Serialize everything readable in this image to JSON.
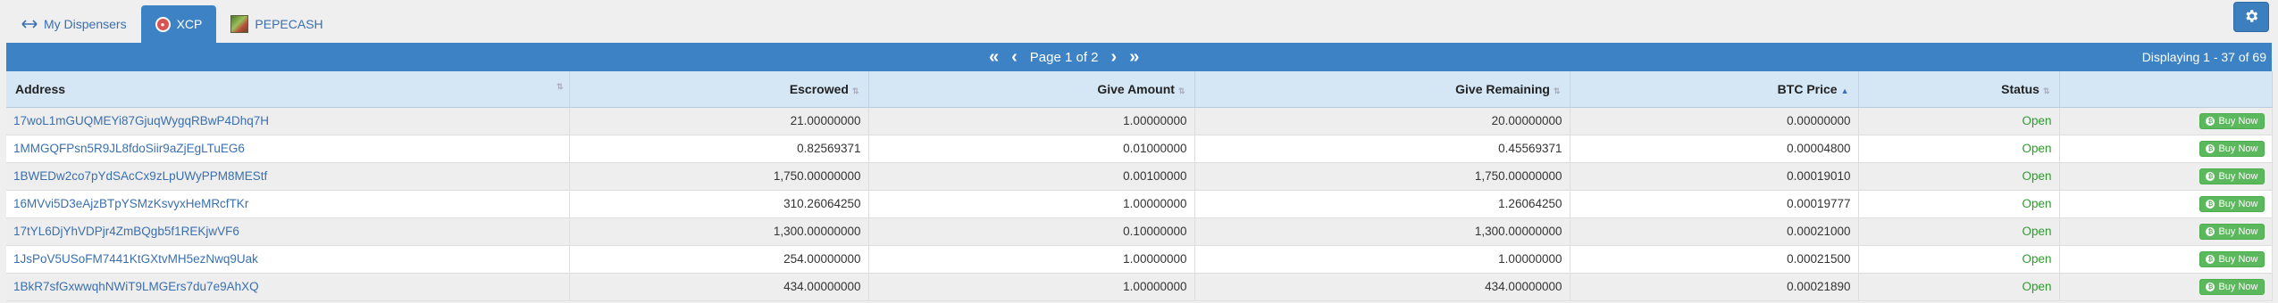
{
  "tabs": [
    {
      "label": "My Dispensers",
      "icon": "double-arrow-icon"
    },
    {
      "label": "XCP",
      "icon": "xcp-logo-icon",
      "active": true
    },
    {
      "label": "PEPECASH",
      "icon": "pepecash-logo-icon"
    }
  ],
  "settings": {
    "icon": "gear-icon"
  },
  "pager": {
    "page_text": "Page 1 of 2",
    "displaying": "Displaying 1 - 37 of 69"
  },
  "columns": [
    "Address",
    "Escrowed",
    "Give Amount",
    "Give Remaining",
    "BTC Price",
    "Status",
    ""
  ],
  "rows": [
    {
      "address": "17woL1mGUQMEYi87GjuqWygqRBwP4Dhq7H",
      "escrowed": "21.00000000",
      "give_amount": "1.00000000",
      "give_remaining": "20.00000000",
      "btc_price": "0.00000000",
      "status": "Open",
      "action": "Buy Now"
    },
    {
      "address": "1MMGQFPsn5R9JL8fdoSiir9aZjEgLTuEG6",
      "escrowed": "0.82569371",
      "give_amount": "0.01000000",
      "give_remaining": "0.45569371",
      "btc_price": "0.00004800",
      "status": "Open",
      "action": "Buy Now"
    },
    {
      "address": "1BWEDw2co7pYdSAcCx9zLpUWyPPM8MEStf",
      "escrowed": "1,750.00000000",
      "give_amount": "0.00100000",
      "give_remaining": "1,750.00000000",
      "btc_price": "0.00019010",
      "status": "Open",
      "action": "Buy Now"
    },
    {
      "address": "16MVvi5D3eAjzBTpYSMzKsvyxHeMRcfTKr",
      "escrowed": "310.26064250",
      "give_amount": "1.00000000",
      "give_remaining": "1.26064250",
      "btc_price": "0.00019777",
      "status": "Open",
      "action": "Buy Now"
    },
    {
      "address": "17tYL6DjYhVDPjr4ZmBQgb5f1REKjwVF6",
      "escrowed": "1,300.00000000",
      "give_amount": "0.10000000",
      "give_remaining": "1,300.00000000",
      "btc_price": "0.00021000",
      "status": "Open",
      "action": "Buy Now"
    },
    {
      "address": "1JsPoV5USoFM7441KtGXtvMH5ezNwq9Uak",
      "escrowed": "254.00000000",
      "give_amount": "1.00000000",
      "give_remaining": "1.00000000",
      "btc_price": "0.00021500",
      "status": "Open",
      "action": "Buy Now"
    },
    {
      "address": "1BkR7sfGxwwqhNWiT9LMGErs7du7e9AhXQ",
      "escrowed": "434.00000000",
      "give_amount": "1.00000000",
      "give_remaining": "434.00000000",
      "btc_price": "0.00021890",
      "status": "Open",
      "action": "Buy Now"
    }
  ],
  "colors": {
    "accent": "#3c82c5",
    "header_bg": "#d5e6f5",
    "status_open": "#2e9a2e",
    "buy_button": "#5cb85c"
  }
}
